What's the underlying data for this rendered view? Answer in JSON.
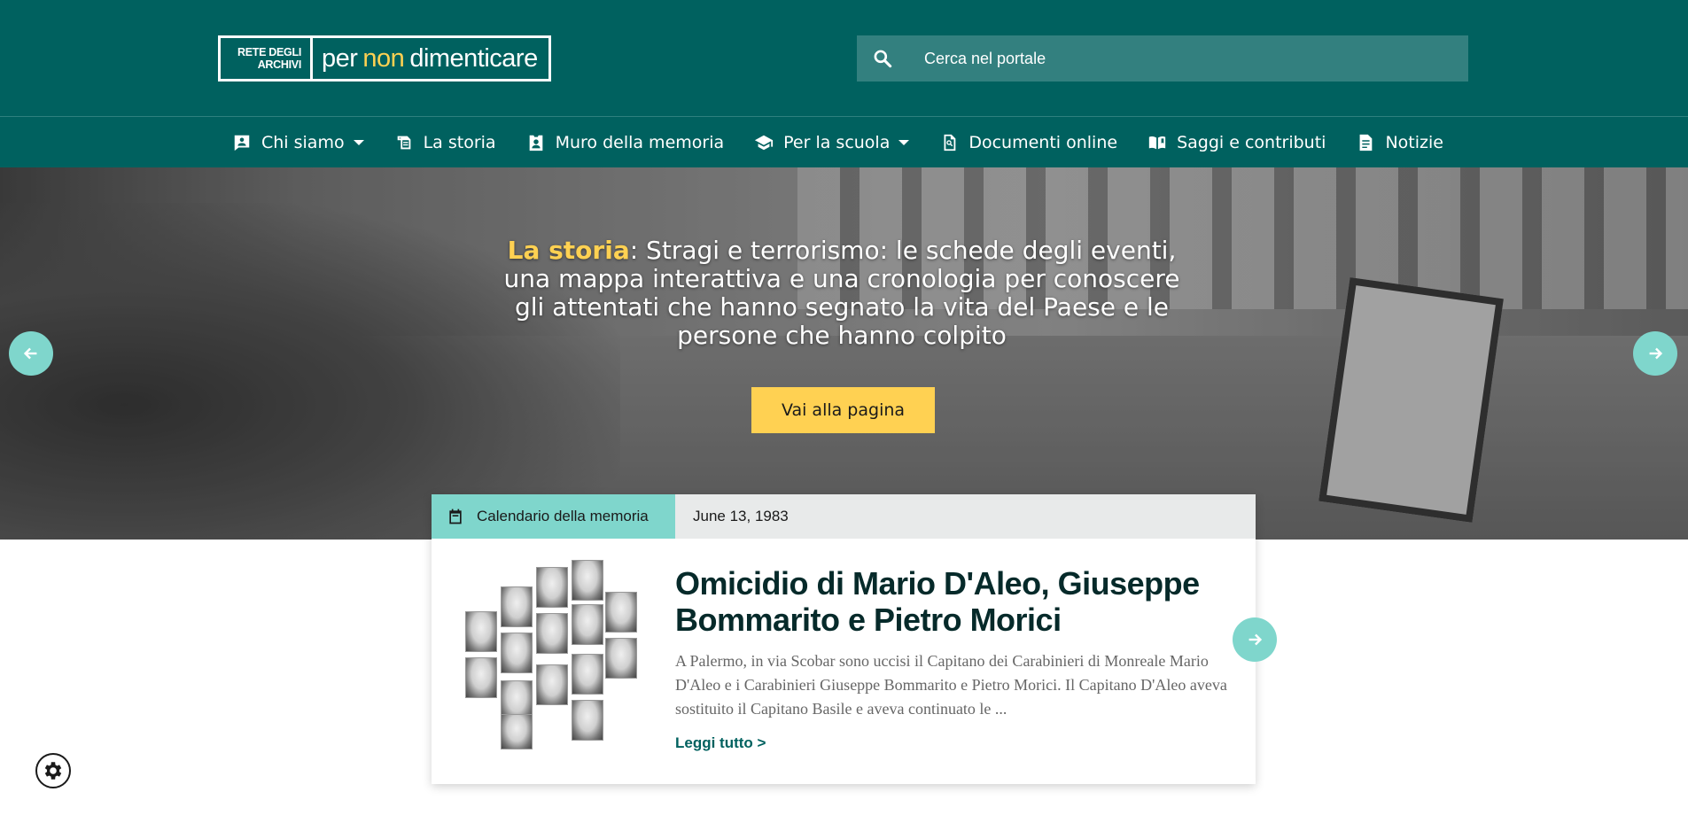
{
  "header": {
    "logo_left": "RETE DEGLI ARCHIVI",
    "logo_left_line1": "RETE DEGLI",
    "logo_left_line2": "ARCHIVI",
    "logo_right_pre": "per",
    "logo_right_hl": "non",
    "logo_right_post": "dimenticare",
    "search_placeholder": "Cerca nel portale"
  },
  "nav": {
    "items": [
      {
        "label": "Chi siamo",
        "icon": "contact-card-icon",
        "has_dropdown": true
      },
      {
        "label": "La storia",
        "icon": "history-icon",
        "has_dropdown": false
      },
      {
        "label": "Muro della memoria",
        "icon": "badge-icon",
        "has_dropdown": false
      },
      {
        "label": "Per la scuola",
        "icon": "school-icon",
        "has_dropdown": true
      },
      {
        "label": "Documenti online",
        "icon": "document-search-icon",
        "has_dropdown": false
      },
      {
        "label": "Saggi e contributi",
        "icon": "book-icon",
        "has_dropdown": false
      },
      {
        "label": "Notizie",
        "icon": "article-icon",
        "has_dropdown": false
      }
    ]
  },
  "hero": {
    "highlight": "La storia",
    "text": ": Stragi e terrorismo: le schede degli eventi, una mappa interattiva e una cronologia per conoscere gli attentati che hanno segnato la vita del Paese e le persone che hanno colpito",
    "button_label": "Vai alla pagina"
  },
  "card": {
    "tag": "Calendario della memoria",
    "date": "June 13, 1983",
    "title": "Omicidio di Mario D'Aleo, Giuseppe Bommarito e Pietro Morici",
    "description": "A Palermo, in via Scobar sono uccisi il Capitano dei Carabinieri di Monreale Mario D'Aleo e i Carabinieri Giuseppe Bommarito e Pietro Morici. Il Capitano D'Aleo aveva sostituito il Capitano Basile e aveva continuato le ...",
    "read_more": "Leggi tutto >"
  },
  "colors": {
    "brand": "#00615f",
    "accent": "#ffd152",
    "teal_light": "#7fd6cc"
  }
}
